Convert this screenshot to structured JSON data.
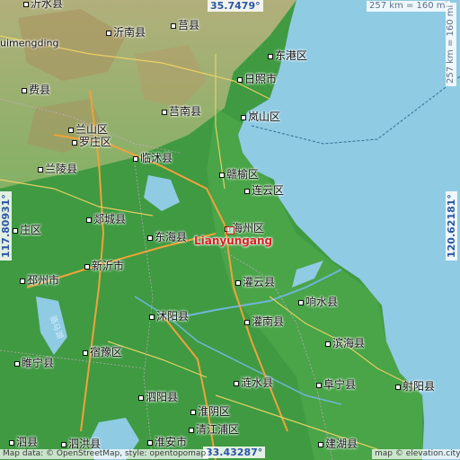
{
  "map": {
    "focus_city": {
      "name": "Lianyungang"
    },
    "coords": {
      "top": "35.7479°",
      "bottom": "33.43287°",
      "left": "117.80931°",
      "right": "120.62181°"
    },
    "scale": {
      "top": "257 km = 160 mi",
      "right": "257 km = 160 mi"
    },
    "places": [
      "莒县",
      "沂南县",
      "东港区",
      "费县",
      "日照市",
      "莒南县",
      "兰山区",
      "罗庄区",
      "岚山区",
      "临沭县",
      "兰陵县",
      "赣榆区",
      "连云区",
      "郯城县",
      "海州区",
      "东海县",
      "新沂市",
      "邳州市",
      "灌云县",
      "响水县",
      "沭阳县",
      "灌南县",
      "滨海县",
      "睢宁县",
      "宿豫区",
      "阜宁县",
      "涟水县",
      "射阳县",
      "泗阳县",
      "淮阴区",
      "清江浦区",
      "淮安市",
      "泗洪县",
      "建湖县",
      "泗县",
      "沂水县",
      "庄区",
      "uimengding"
    ],
    "water_label": "骆马湖",
    "credit_left": "Map data: © OpenStreetMap, style: opentopomap",
    "credit_right": "map © elevation.city",
    "icons": {
      "city_marker": "square-dot-icon",
      "focus_marker": "red-square-marker-icon"
    },
    "colors": {
      "sea": "#8fcbe3",
      "lowland": "#3f9a42",
      "hills": "#b9a57a",
      "focus": "#d62222",
      "coord_text": "#2b57a6"
    }
  }
}
